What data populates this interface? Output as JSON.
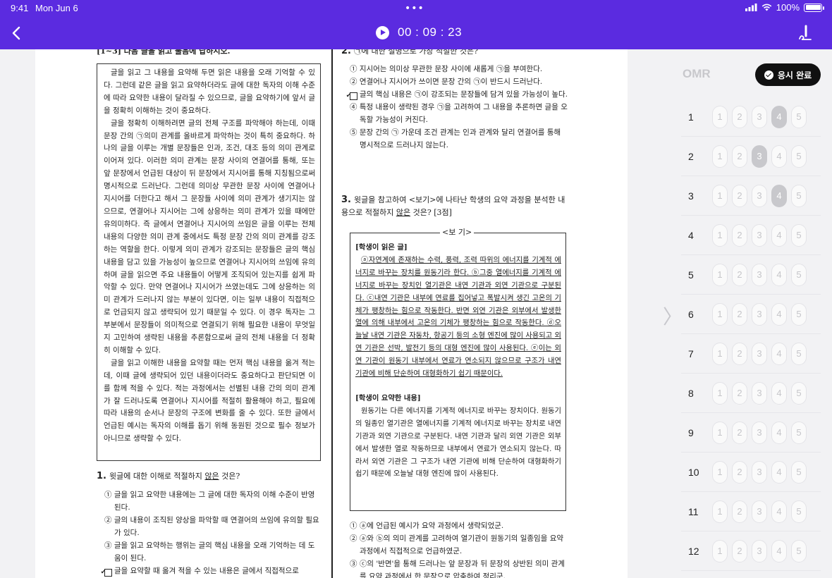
{
  "status": {
    "time": "9:41",
    "date": "Mon Jun 6",
    "dots": "•••",
    "battery_text": "100%",
    "battery_level": 1.0
  },
  "header": {
    "timer": "00 : 09 : 23",
    "back_icon": "chevron-left-icon",
    "pen_icon": "pen-icon",
    "bg_color": "#5b2be0"
  },
  "paper": {
    "instruction": "[1~3] 다음 글을 읽고 물음에 답하시오.",
    "passage": [
      "글을 읽고 그 내용을 요약해 두면 읽은 내용을 오래 기억할 수 있다. 그런데 같은 글을 읽고 요약하더라도 글에 대한 독자의 이해 수준에 따라 요약한 내용이 달라질 수 있으므로, 글을 요약하기에 앞서 글을 정확히 이해하는 것이 중요하다.",
      "글을 정확히 이해하려면 글의 전체 구조를 파악해야 하는데, 이때 문장 간의 ㉠의미 관계를 올바르게 파악하는 것이 특히 중요하다. 하나의 글을 이루는 개별 문장들은 인과, 조건, 대조 등의 의미 관계로 이어져 있다. 이러한 의미 관계는 문장 사이의 연결어를 통해, 또는 앞 문장에서 언급된 대상이 뒤 문장에서 지시어를 통해 지칭됨으로써 명시적으로 드러난다. 그런데 의미상 무관한 문장 사이에 연결어나 지시어를 더한다고 해서 그 문장들 사이에 의미 관계가 생기지는 않으므로, 연결어나 지시어는 그에 상응하는 의미 관계가 있을 때에만 유의미하다. 즉 글에서 연결어나 지시어의 쓰임은 글을 이루는 전체 내용의 다양한 의미 관계 중에서도 특정 문장 간의 의미 관계를 강조하는 역할을 한다. 이렇게 의미 관계가 강조되는 문장들은 글의 핵심 내용을 담고 있을 가능성이 높으므로 연결어나 지시어의 쓰임에 유의하며 글을 읽으면 주요 내용들이 어떻게 조직되어 있는지를 쉽게 파악할 수 있다. 만약 연결어나 지시어가 쓰였는데도 그에 상응하는 의미 관계가 드러나지 않는 부분이 있다면, 이는 일부 내용이 직접적으로 언급되지 않고 생략되어 있기 때문일 수 있다. 이 경우 독자는 그 부분에서 문장들이 의미적으로 연결되기 위해 필요한 내용이 무엇일지 고민하여 생략된 내용을 추론함으로써 글의 전체 내용을 더 정확히 이해할 수 있다.",
      "글을 읽고 이해한 내용을 요약할 때는 먼저 핵심 내용을 옮겨 적는데, 이때 글에 생략되어 있던 내용이더라도 중요하다고 판단되면 이를 함께 적을 수 있다. 적는 과정에서는 선별된 내용 간의 의미 관계가 잘 드러나도록 연결어나 지시어를 적절히 활용해야 하고, 필요에 따라 내용의 순서나 문장의 구조에 변화를 줄 수 있다. 또한 글에서 언급된 예시는 독자의 이해를 돕기 위해 동원된 것으로 필수 정보가 아니므로 생략할 수 있다."
    ],
    "q1": {
      "num": "1.",
      "title_pre": "윗글에 대한 이해로 적절하지 ",
      "title_u": "않은",
      "title_post": " 것은?",
      "options": [
        "① 글을 읽고 요약한 내용에는 그 글에 대한 독자의 이해 수준이 반영된다.",
        "② 글의 내용이 조직된 양상을 파악할 때 연결어의 쓰임에 유의할 필요가 있다.",
        "③ 글을 읽고 요약하는 행위는 글의 핵심 내용을 오래 기억하는 데 도움이 된다.",
        "글을 요약할 때 옮겨 적을 수 있는 내용은 글에서 직접적으로"
      ]
    },
    "q2": {
      "num": "2.",
      "title": "㉠에 대한 설명으로 가장 적절한 것은?",
      "options": [
        "① 지시어는 의미상 무관한 문장 사이에 새롭게 ㉠을 부여한다.",
        "② 연결어나 지시어가 쓰이면 문장 간의 ㉠이 반드시 드러난다.",
        "글의 핵심 내용은 ㉠이 강조되는 문장들에 담겨 있을 가능성이 높다.",
        "④ 특정 내용이 생략된 경우 ㉠을 고려하여 그 내용을 추론하면 글을 오독할 가능성이 커진다.",
        "⑤ 문장 간의 ㉠ 가운데 조건 관계는 인과 관계와 달리 연결어를 통해 명시적으로 드러나지 않는다."
      ]
    },
    "q3": {
      "num": "3.",
      "title_pre": "윗글을 참고하여 <보기>에 나타난 학생의 요약 과정을 분석한 내용으로 적절하지 ",
      "title_u": "않은",
      "title_post": " 것은? [3점]",
      "bogi_label": "<보 기>",
      "read_head": "[학생이 읽은 글]",
      "read_text": "ⓐ자연계에 존재하는 수력, 풍력, 조력 따위의 에너지를 기계적 에너지로 바꾸는 장치를 원동기라 한다. ⓑ그중 열에너지를 기계적 에너지로 바꾸는 장치인 열기관은 내연 기관과 외연 기관으로 구분된다. ⓒ내연 기관은 내부에 연료를 집어넣고 폭발시켜 생긴 고온의 기체가 팽창하는 힘으로 작동한다. 반면 외연 기관은 외부에서 발생한 열에 의해 내부에서 고온의 기체가 팽창하는 힘으로 작동한다. ⓓ오늘날 내연 기관은 자동차, 항공기 등의 소형 엔진에 많이 사용되고 외연 기관은 선박, 발전기 등의 대형 엔진에 많이 사용된다. ⓔ이는 외연 기관이 원동기 내부에서 연료가 연소되지 않으므로 구조가 내연 기관에 비해 단순하여 대형화하기 쉽기 때문이다.",
      "summary_head": "[학생이 요약한 내용]",
      "summary_text": "원동기는 다른 에너지를 기계적 에너지로 바꾸는 장치이다. 원동기의 일종인 열기관은 열에너지를 기계적 에너지로 바꾸는 장치로 내연 기관과 외연 기관으로 구분된다. 내연 기관과 달리 외연 기관은 외부에서 발생한 열로 작동하므로 내부에서 연료가 연소되지 않는다. 따라서 외연 기관은 그 구조가 내연 기관에 비해 단순하여 대형화하기 쉽기 때문에 오늘날 대형 엔진에 많이 사용된다.",
      "options": [
        "① ⓐ에 언급된 예시가 요약 과정에서 생략되었군.",
        "② ⓐ와 ⓑ의 의미 관계를 고려하여 열기관이 원동기의 일종임을 요약 과정에서 직접적으로 언급하였군.",
        "③ ⓒ의 '반면'을 통해 드러나는 앞 문장과 뒤 문장의 상반된 의미 관계를 요약 과정에서 한 문장으로 압축하여 정리군."
      ]
    }
  },
  "omr": {
    "title": "OMR",
    "submit_label": "응시 완료",
    "submit_icon": "check-circle-icon",
    "handle_icon": "chevron-right-icon",
    "choices": [
      "1",
      "2",
      "3",
      "4",
      "5"
    ],
    "rows": [
      {
        "num": "1",
        "selected": 4
      },
      {
        "num": "2",
        "selected": 3
      },
      {
        "num": "3",
        "selected": 4
      },
      {
        "num": "4",
        "selected": null
      },
      {
        "num": "5",
        "selected": null
      },
      {
        "num": "6",
        "selected": null
      },
      {
        "num": "7",
        "selected": null
      },
      {
        "num": "8",
        "selected": null
      },
      {
        "num": "9",
        "selected": null
      },
      {
        "num": "10",
        "selected": null
      },
      {
        "num": "11",
        "selected": null
      },
      {
        "num": "12",
        "selected": null
      }
    ]
  }
}
